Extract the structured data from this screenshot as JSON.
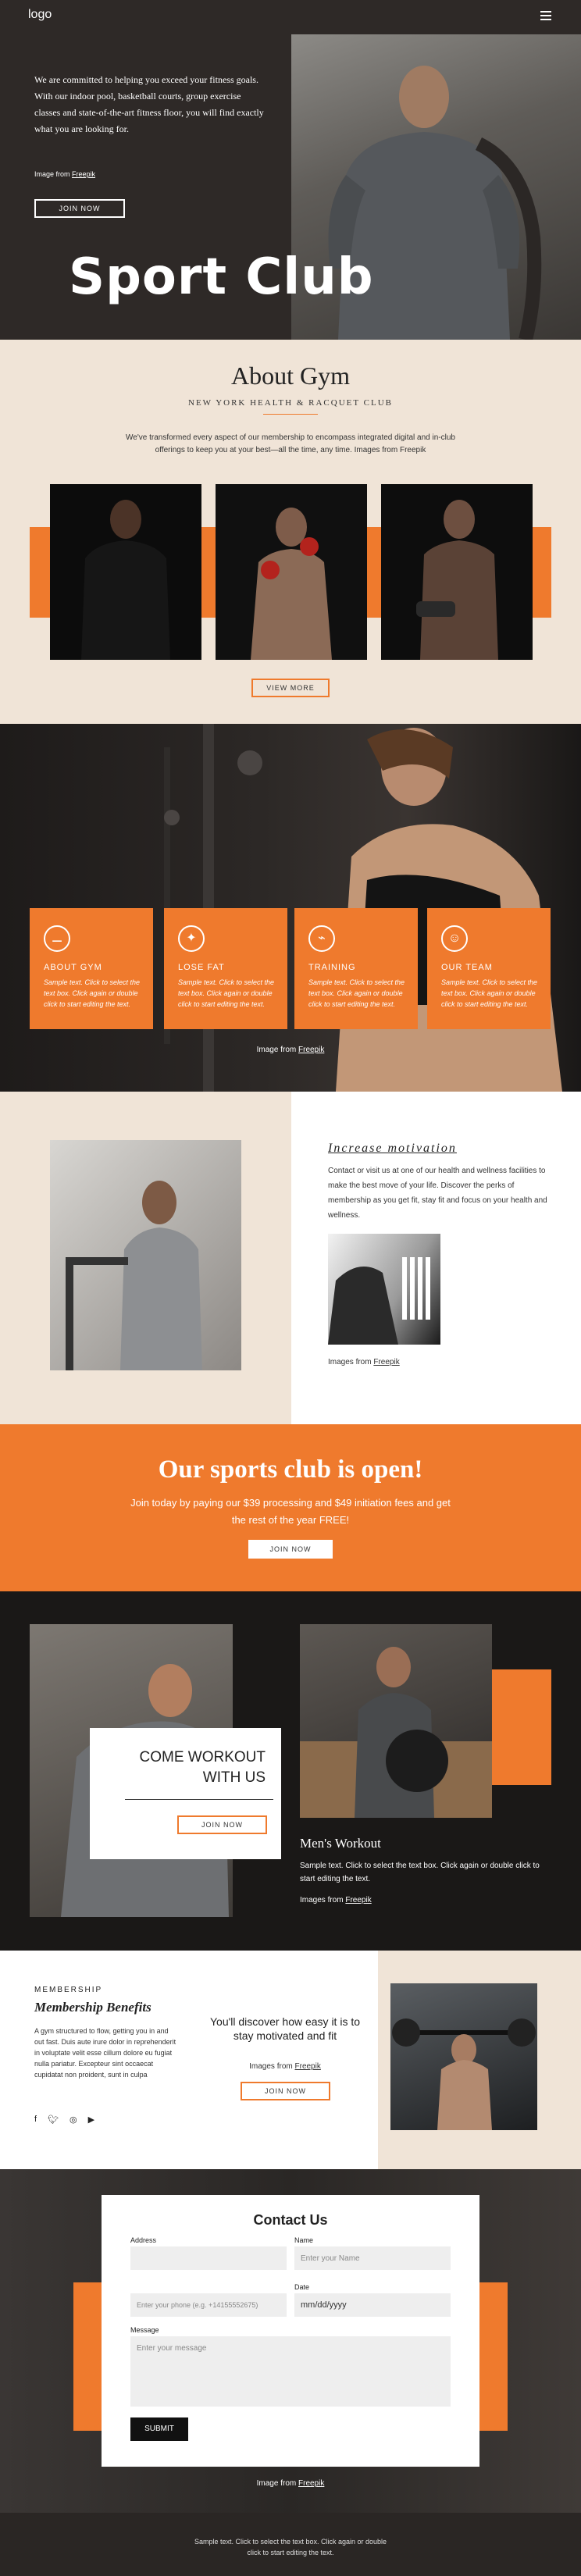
{
  "header": {
    "logo": "logo",
    "menu_icon": "hamburger-icon"
  },
  "hero": {
    "text": "We are committed to helping you exceed your fitness goals. With our indoor pool, basketball courts, group exercise classes and state-of-the-art fitness floor, you will find exactly what you are looking for.",
    "credit_prefix": "Image from ",
    "credit_link": "Freepik",
    "button": "JOIN NOW",
    "title": "Sport Club"
  },
  "about": {
    "title": "About Gym",
    "subtitle": "NEW YORK HEALTH & RACQUET CLUB",
    "text": "We've transformed every aspect of our membership to encompass integrated digital and in-club offerings to keep you at your best—all the time, any time.  Images from Freepik",
    "button": "VIEW MORE"
  },
  "training": {
    "cards": [
      {
        "icon": "dumbbell-icon",
        "title": "ABOUT GYM",
        "text": "Sample text. Click to select the text box. Click again or double click to start editing the text."
      },
      {
        "icon": "muscle-icon",
        "title": "LOSE FAT",
        "text": "Sample text. Click to select the text box. Click again or double click to start editing the text."
      },
      {
        "icon": "training-icon",
        "title": "TRAINING",
        "text": "Sample text. Click to select the text box. Click again or double click to start editing the text."
      },
      {
        "icon": "team-icon",
        "title": "OUR TEAM",
        "text": "Sample text. Click to select the text box. Click again or double click to start editing the text."
      }
    ],
    "credit_prefix": "Image from ",
    "credit_link": "Freepik"
  },
  "motivation": {
    "title": "Increase motivation",
    "text": "Contact or visit us at one of our health and wellness facilities to make the best move of your life. Discover the perks of membership as you get fit, stay fit and focus on your health and wellness.",
    "credit_prefix": "Images from ",
    "credit_link": "Freepik"
  },
  "open": {
    "title": "Our sports club is open!",
    "text": "Join today by paying our $39 processing and $49 initiation fees and get the rest of the year FREE!",
    "button": "JOIN NOW"
  },
  "workout": {
    "card_title": "COME WORKOUT WITH US",
    "card_button": "JOIN NOW",
    "mens_title": "Men's Workout",
    "mens_text": "Sample text. Click to select the text box. Click again or double click to start editing the text.",
    "credit_prefix": "Images from ",
    "credit_link": "Freepik"
  },
  "membership": {
    "eyebrow": "MEMBERSHIP",
    "title": "Membership Benefits",
    "text": "A gym structured to flow, getting you in and out fast. Duis aute irure dolor in reprehenderit in voluptate velit esse cillum dolore eu fugiat nulla pariatur. Excepteur sint occaecat cupidatat non proident, sunt in culpa",
    "center_title": "You'll discover how easy it is to stay motivated and fit",
    "credit_prefix": "Images from ",
    "credit_link": "Freepik",
    "button": "JOIN NOW",
    "social": [
      "facebook-icon",
      "twitter-icon",
      "instagram-icon",
      "youtube-icon"
    ]
  },
  "contact": {
    "title": "Contact Us",
    "address_label": "Address",
    "name_label": "Name",
    "name_placeholder": "Enter your Name",
    "phone_placeholder": "Enter your phone (e.g. +14155552675)",
    "date_label": "Date",
    "date_placeholder": "mm/dd/yyyy",
    "message_label": "Message",
    "message_placeholder": "Enter your message",
    "submit": "SUBMIT",
    "credit_prefix": "Image from ",
    "credit_link": "Freepik"
  },
  "footer": {
    "text": "Sample text. Click to select the text box. Click again or double click to start editing the text."
  },
  "colors": {
    "accent": "#ef7a2d",
    "dark": "#2a2624",
    "beige": "#f0e4d7"
  }
}
